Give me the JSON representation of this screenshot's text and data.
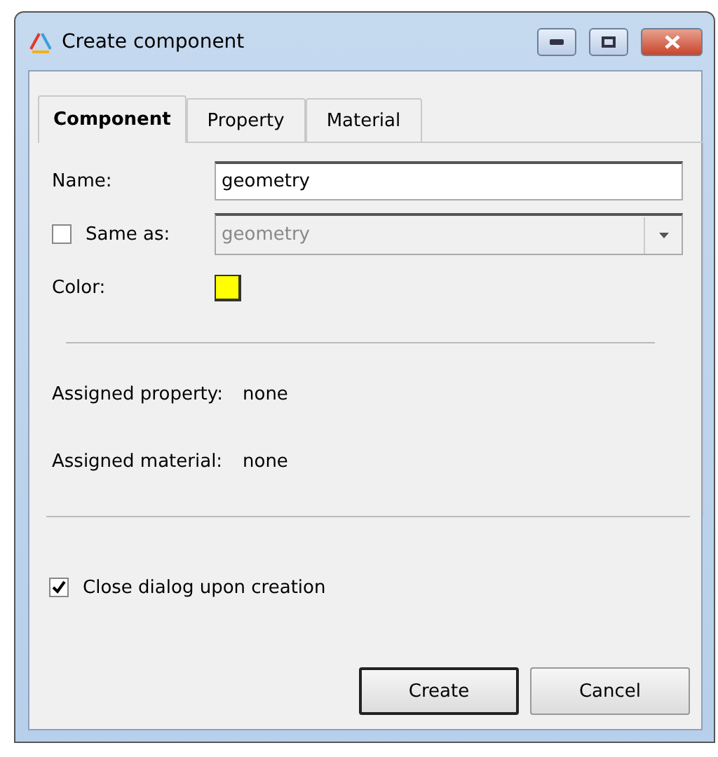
{
  "window": {
    "title": "Create component"
  },
  "tabs": [
    {
      "label": "Component",
      "selected": true
    },
    {
      "label": "Property",
      "selected": false
    },
    {
      "label": "Material",
      "selected": false
    }
  ],
  "name_field": {
    "label": "Name:",
    "value": "geometry"
  },
  "same_as": {
    "label": "Same as:",
    "checked": false,
    "value": "geometry",
    "disabled": true
  },
  "color": {
    "label": "Color:",
    "color": "#ffff00"
  },
  "assigned": [
    {
      "label": "Assigned property:",
      "value": "none"
    },
    {
      "label": "Assigned material:",
      "value": "none"
    }
  ],
  "close_on_create": {
    "label": "Close dialog upon creation",
    "checked": true
  },
  "buttons": [
    {
      "label": "Create",
      "default": true
    },
    {
      "label": "Cancel",
      "default": false
    }
  ]
}
